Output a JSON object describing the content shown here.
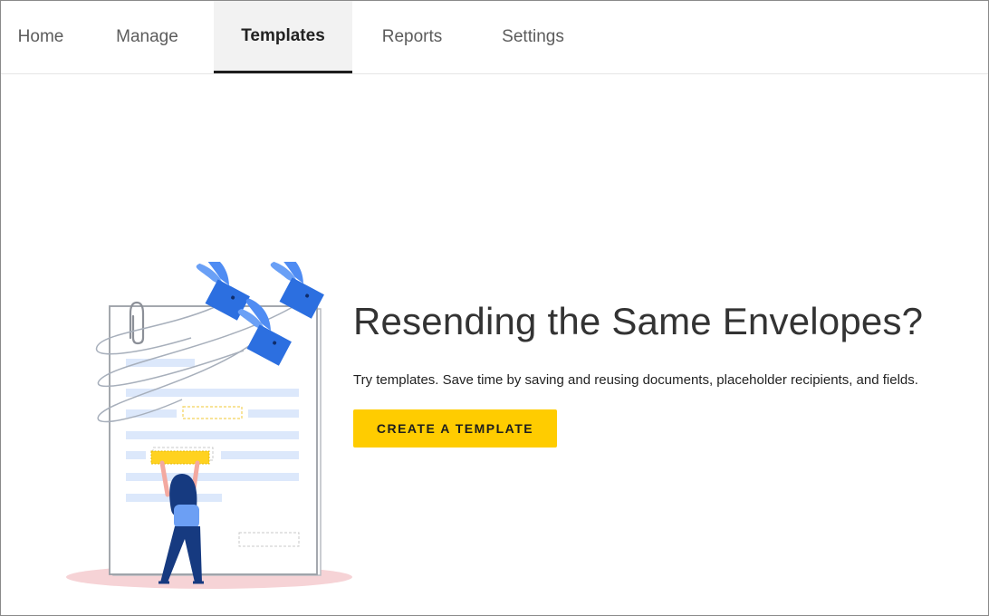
{
  "nav": {
    "tabs": [
      {
        "label": "Home",
        "active": false
      },
      {
        "label": "Manage",
        "active": false
      },
      {
        "label": "Templates",
        "active": true
      },
      {
        "label": "Reports",
        "active": false
      },
      {
        "label": "Settings",
        "active": false
      }
    ]
  },
  "hero": {
    "title": "Resending the Same Envelopes?",
    "subtitle": "Try templates. Save time by saving and reusing documents, placeholder recipients, and fields.",
    "cta_label": "CREATE A TEMPLATE"
  },
  "colors": {
    "accent_yellow": "#ffcc00",
    "illustration_blue": "#2c6fe0",
    "figure_navy": "#163a80",
    "shadow_pink": "#f6d3d6"
  },
  "illustration": {
    "icons": [
      "document-icon",
      "paperclip-icon",
      "winged-envelope-icon",
      "woman-figure-icon"
    ]
  }
}
